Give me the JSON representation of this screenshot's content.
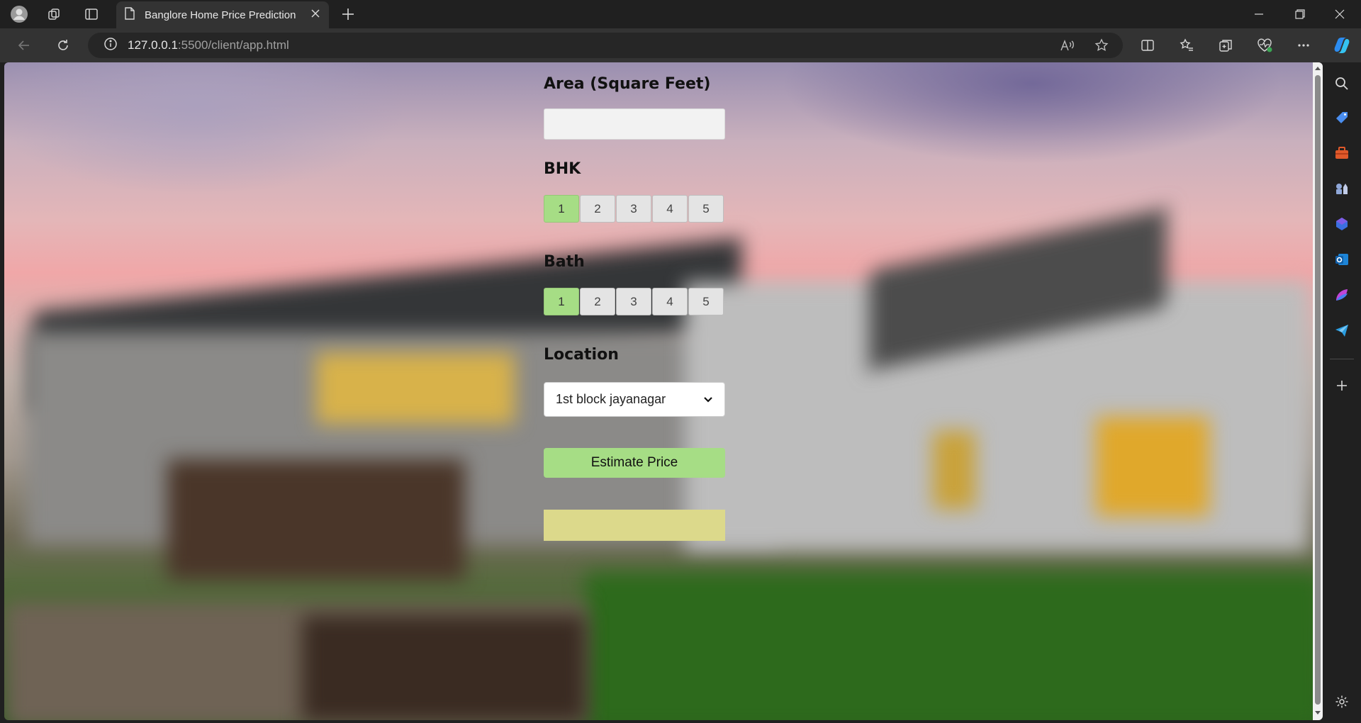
{
  "browser": {
    "tab_title": "Banglore Home Price Prediction",
    "url_host": "127.0.0.1",
    "url_rest": ":5500/client/app.html"
  },
  "form": {
    "area_label": "Area (Square Feet)",
    "area_value": "",
    "bhk_label": "BHK",
    "bhk_options": [
      "1",
      "2",
      "3",
      "4",
      "5"
    ],
    "bhk_selected": "1",
    "bath_label": "Bath",
    "bath_options": [
      "1",
      "2",
      "3",
      "4",
      "5"
    ],
    "bath_selected": "1",
    "location_label": "Location",
    "location_value": "1st block jayanagar",
    "estimate_label": "Estimate Price",
    "result_text": ""
  },
  "colors": {
    "selected_option": "#a6dd85",
    "estimate_button": "#a6dd85",
    "result_box": "#dcd98b"
  },
  "icons": {
    "sidebar": [
      "search-icon",
      "tag-icon",
      "toolbox-icon",
      "chess-icon",
      "copilot-icon",
      "outlook-icon",
      "designer-icon",
      "send-icon",
      "add-icon",
      "settings-icon"
    ]
  }
}
